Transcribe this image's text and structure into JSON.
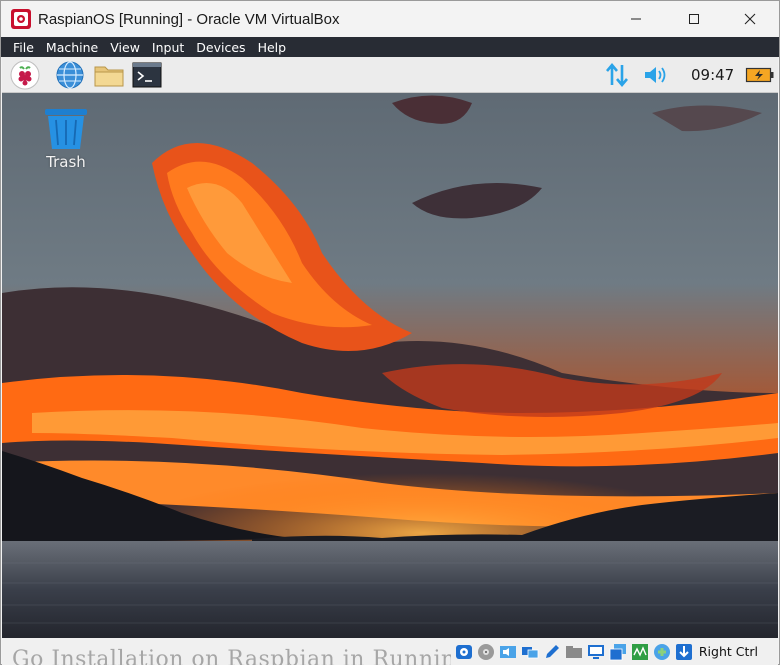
{
  "window": {
    "title": "RaspianOS [Running] - Oracle VM VirtualBox"
  },
  "menubar": {
    "items": [
      "File",
      "Machine",
      "View",
      "Input",
      "Devices",
      "Help"
    ]
  },
  "panel": {
    "launchers": [
      "raspberry-menu-icon",
      "web-browser-icon",
      "file-manager-icon",
      "terminal-icon"
    ],
    "tray_icons": [
      "network-transfer-icon",
      "volume-icon",
      "battery-charging-icon"
    ],
    "clock": "09:47"
  },
  "desktop": {
    "trash_label": "Trash"
  },
  "statusbar": {
    "background_text": "Go Installation on Raspbian in Running VirtualBox",
    "icons": [
      "hard-disk-icon",
      "optical-drive-icon",
      "audio-icon",
      "network-icon",
      "usb-icon",
      "shared-folders-icon",
      "display-icon",
      "recording-icon",
      "cpu-activity-icon",
      "vm-settings-icon",
      "mouse-integration-icon"
    ],
    "host_key": "Right Ctrl"
  },
  "colors": {
    "menubar_bg": "#282c34",
    "panel_bg": "#ececec",
    "accent_blue": "#2aa3e8",
    "battery_orange": "#f5a623"
  }
}
